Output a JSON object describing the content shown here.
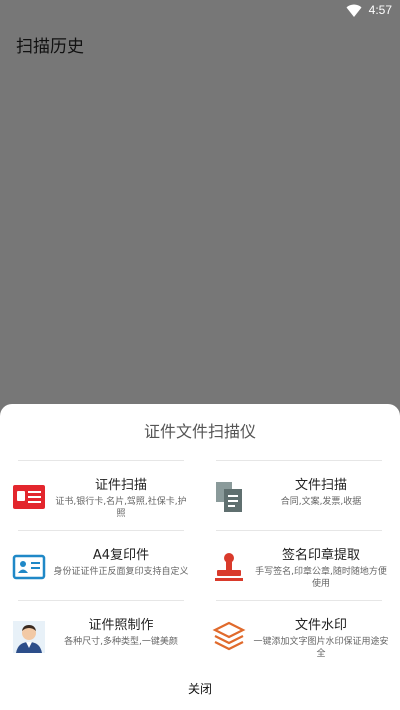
{
  "status": {
    "time": "4:57"
  },
  "appbar": {
    "title": "扫描历史"
  },
  "sheet": {
    "title": "证件文件扫描仪",
    "items": [
      {
        "name": "证件扫描",
        "desc": "证书,银行卡,名片,驾照,社保卡,护照",
        "icon": "id-card-icon"
      },
      {
        "name": "文件扫描",
        "desc": "合同,文案,发票,收据",
        "icon": "document-copy-icon"
      },
      {
        "name": "A4复印件",
        "desc": "身份证证件正反面复印支持自定义",
        "icon": "id-card-outline-icon"
      },
      {
        "name": "签名印章提取",
        "desc": "手写签名,印章公章,随时随地方便使用",
        "icon": "stamp-icon"
      },
      {
        "name": "证件照制作",
        "desc": "各种尺寸,多种类型,一键美颜",
        "icon": "portrait-icon"
      },
      {
        "name": "文件水印",
        "desc": "一键添加文字图片水印保证用途安全",
        "icon": "layers-icon"
      }
    ],
    "close_label": "关闭"
  }
}
